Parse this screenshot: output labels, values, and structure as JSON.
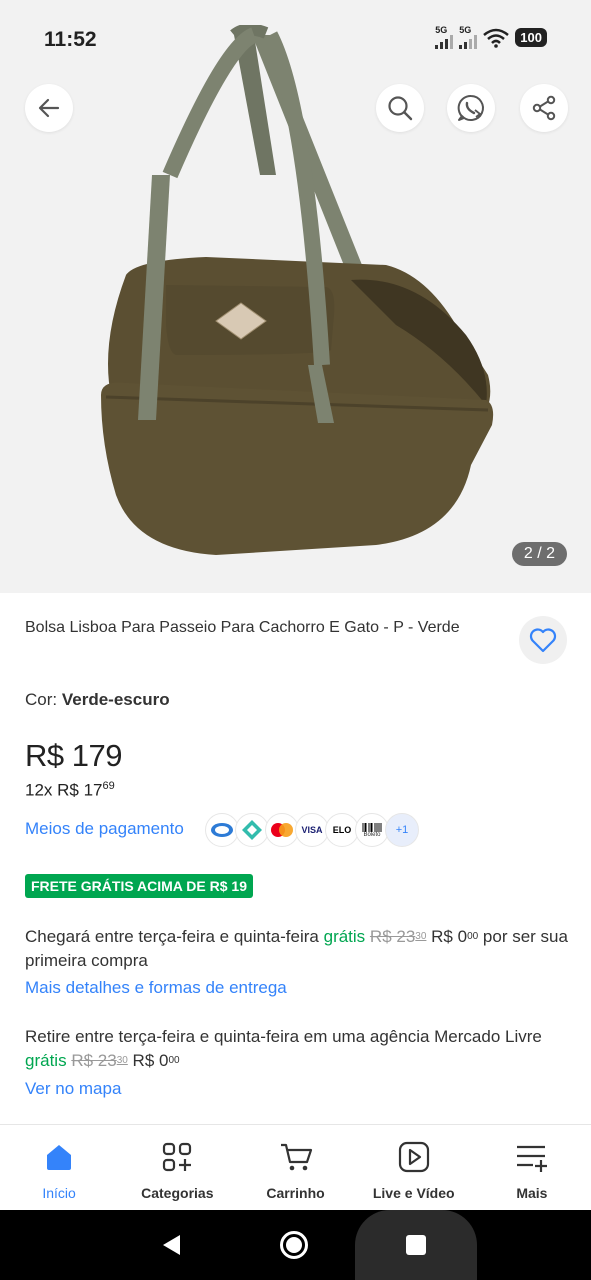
{
  "status_bar": {
    "time": "11:52",
    "signal1": "5G",
    "signal2": "5G",
    "battery": "100"
  },
  "header": {
    "back_icon": "arrow-left-icon",
    "search_icon": "search-icon",
    "whatsapp_icon": "whatsapp-icon",
    "share_icon": "share-icon"
  },
  "gallery": {
    "counter": "2 / 2"
  },
  "product": {
    "title": "Bolsa Lisboa Para Passeio Para Cachorro E Gato - P - Verde",
    "color_label": "Cor:",
    "color_value": "Verde-escuro",
    "price": "R$ 179",
    "installments_prefix": "12x R$ 17",
    "installments_cents": "69",
    "payment_link": "Meios de pagamento",
    "payment_more": "+1",
    "payment_labels": [
      "VISA",
      "ELO",
      "Boleto"
    ],
    "badge": "FRETE GRÁTIS ACIMA DE R$ 19"
  },
  "shipping": {
    "delivery_text_1": "Chegará entre terça-feira e quinta-feira ",
    "delivery_free": "grátis",
    "delivery_old_price": "R$ 23",
    "delivery_old_cents": "30",
    "delivery_new_price": "R$ 0",
    "delivery_new_cents": "00",
    "delivery_text_2": " por ser sua primeira compra",
    "delivery_link": "Mais detalhes e formas de entrega",
    "pickup_text_1": "Retire entre terça-feira e quinta-feira em uma agência Mercado Livre ",
    "pickup_free": "grátis",
    "pickup_old_price": "R$ 23",
    "pickup_old_cents": "30",
    "pickup_new_price": "R$ 0",
    "pickup_new_cents": "00",
    "pickup_link": "Ver no mapa"
  },
  "bottom_nav": {
    "items": [
      {
        "label": "Início",
        "icon": "home-icon",
        "active": true
      },
      {
        "label": "Categorias",
        "icon": "categories-icon",
        "active": false
      },
      {
        "label": "Carrinho",
        "icon": "cart-icon",
        "active": false
      },
      {
        "label": "Live e Vídeo",
        "icon": "play-video-icon",
        "active": false
      },
      {
        "label": "Mais",
        "icon": "menu-plus-icon",
        "active": false
      }
    ]
  },
  "colors": {
    "accent": "#3483fa",
    "green": "#00a650",
    "hero_bg": "#f2f2f2"
  }
}
